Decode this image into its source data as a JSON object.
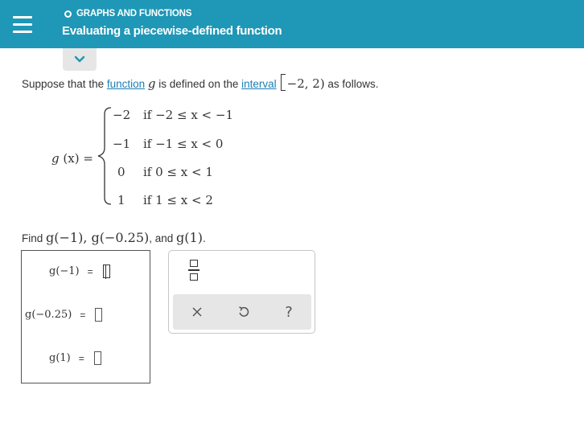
{
  "header": {
    "topic": "GRAPHS AND FUNCTIONS",
    "title": "Evaluating a piecewise-defined function"
  },
  "prompt": {
    "text_1": "Suppose that the ",
    "link_function": "function",
    "text_2": " is defined on the ",
    "link_interval": "interval",
    "text_3": " as follows.",
    "func_name": "g",
    "interval": "−2,  2)"
  },
  "piecewise": {
    "lhs_name": "g",
    "lhs_arg": "(x) =",
    "rows": [
      {
        "value": "−2",
        "condition": "if −2 ≤ x < −1"
      },
      {
        "value": "−1",
        "condition": "if −1 ≤ x < 0"
      },
      {
        "value": "0",
        "condition": "if 0 ≤ x < 1"
      },
      {
        "value": "1",
        "condition": "if 1 ≤ x < 2"
      }
    ]
  },
  "find": {
    "prefix": "Find ",
    "item_1": "g(−1)",
    "sep_1": ", ",
    "item_2": "g(−0.25)",
    "sep_2": ", and ",
    "item_3": "g(1)",
    "suffix": "."
  },
  "answers": [
    {
      "label": "g(−1)",
      "equals": "="
    },
    {
      "label": "g(−0.25)",
      "equals": "="
    },
    {
      "label": "g(1)",
      "equals": "="
    }
  ],
  "toolbar": {
    "icons": [
      "fraction-icon",
      "close-icon",
      "undo-icon",
      "help-icon"
    ],
    "help_label": "?"
  },
  "colors": {
    "header_bg": "#1f97b6",
    "link": "#1a7fb5",
    "toolbar_bg": "#e6e6e6"
  }
}
